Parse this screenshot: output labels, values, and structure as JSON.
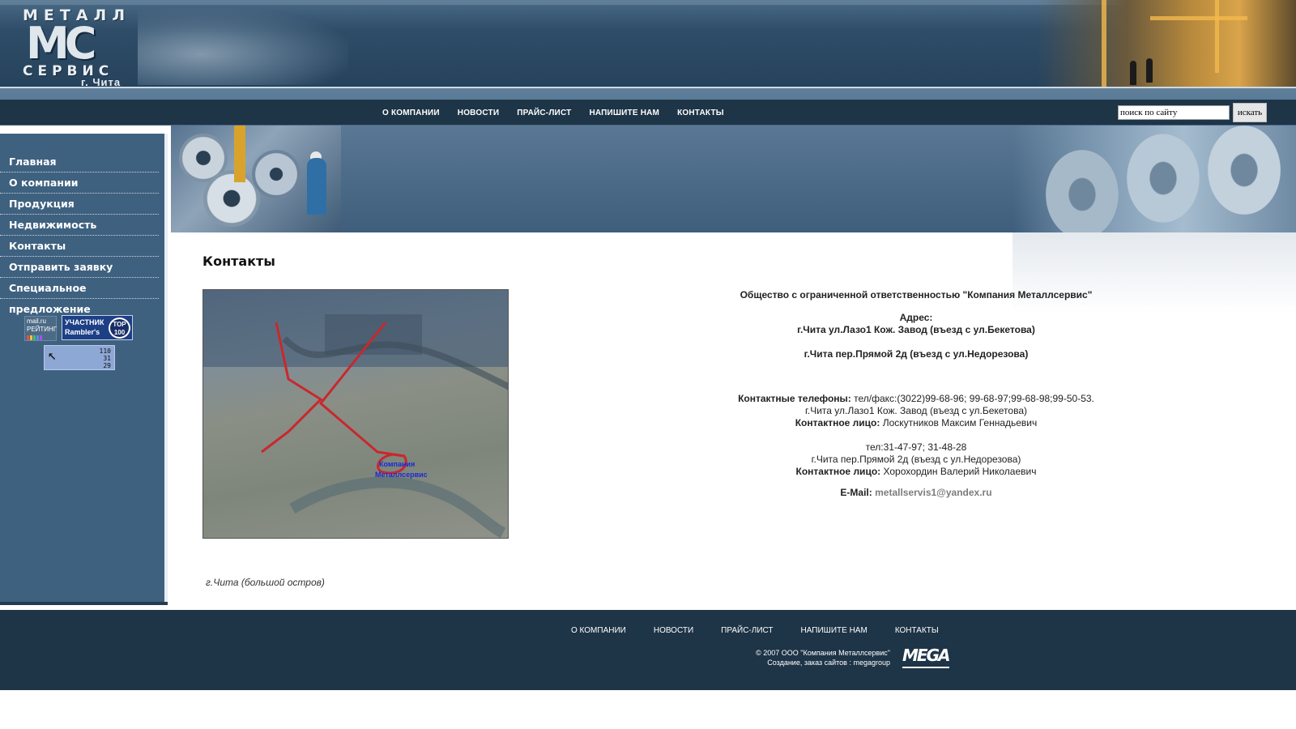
{
  "logo": {
    "word_top": "МЕТАЛЛ",
    "monogram": "МС",
    "word_bottom": "СЕРВИС",
    "city": "г. Чита"
  },
  "top_nav": [
    "О КОМПАНИИ",
    "НОВОСТИ",
    "ПРАЙС-ЛИСТ",
    "НАПИШИТЕ НАМ",
    "КОНТАКТЫ"
  ],
  "search": {
    "value": "поиск по сайту",
    "button": "искать"
  },
  "sidebar": {
    "items": [
      {
        "label": "Главная"
      },
      {
        "label": "О компании"
      },
      {
        "label": "Продукция"
      },
      {
        "label": "Недвижимость"
      },
      {
        "label": "Контакты"
      },
      {
        "label": "Отправить заявку"
      },
      {
        "label": "Специальное предложение"
      }
    ]
  },
  "counters": {
    "mail": {
      "line1": "mail.ru",
      "line2": "РЕЙТИНГ"
    },
    "rambler": {
      "line1": "УЧАСТНИК",
      "line2": "Rambler's",
      "badge": "TOP 100"
    },
    "li": {
      "l1": "110",
      "l2": "31",
      "l3": "29"
    }
  },
  "page": {
    "title": "Контакты",
    "map_caption": "г.Чита (большой остров)",
    "map_label1": "Компания",
    "map_label2": "Металлсервис"
  },
  "contacts": {
    "company": "Общество с ограниченной ответственностью \"Компания Металлсервис\"",
    "address_label": "Адрес:",
    "address1": "г.Чита ул.Лазо1 Кож. Завод (въезд с ул.Бекетова)",
    "address2": "г.Чита пер.Прямой 2д (въезд с ул.Недорезова)",
    "phones_label": "Контактные телефоны:",
    "phones_value": "тел/факс:(3022)99-68-96;        99-68-97;99-68-98;99-50-53.",
    "loc1": "г.Чита ул.Лазо1 Кож. Завод (въезд с ул.Бекетова)",
    "person_label": "Контактное лицо:",
    "person1": "Лоскутников Максим Геннадьевич",
    "phones2": "тел:31-47-97; 31-48-28",
    "loc2": "г.Чита пер.Прямой 2д (въезд с ул.Недорезова)",
    "person2": "Хорохордин Валерий Николаевич",
    "email_label": "E-Mail:",
    "email": "metallservis1@yandex.ru"
  },
  "footer": {
    "links": [
      "О КОМПАНИИ",
      "НОВОСТИ",
      "ПРАЙС-ЛИСТ",
      "НАПИШИТЕ НАМ",
      "КОНТАКТЫ"
    ],
    "copyright": "© 2007 ООО \"Компания Металлсервис\"",
    "credits": "Создание, заказ сайтов     : megagroup",
    "mega_logo": "MEGA"
  }
}
